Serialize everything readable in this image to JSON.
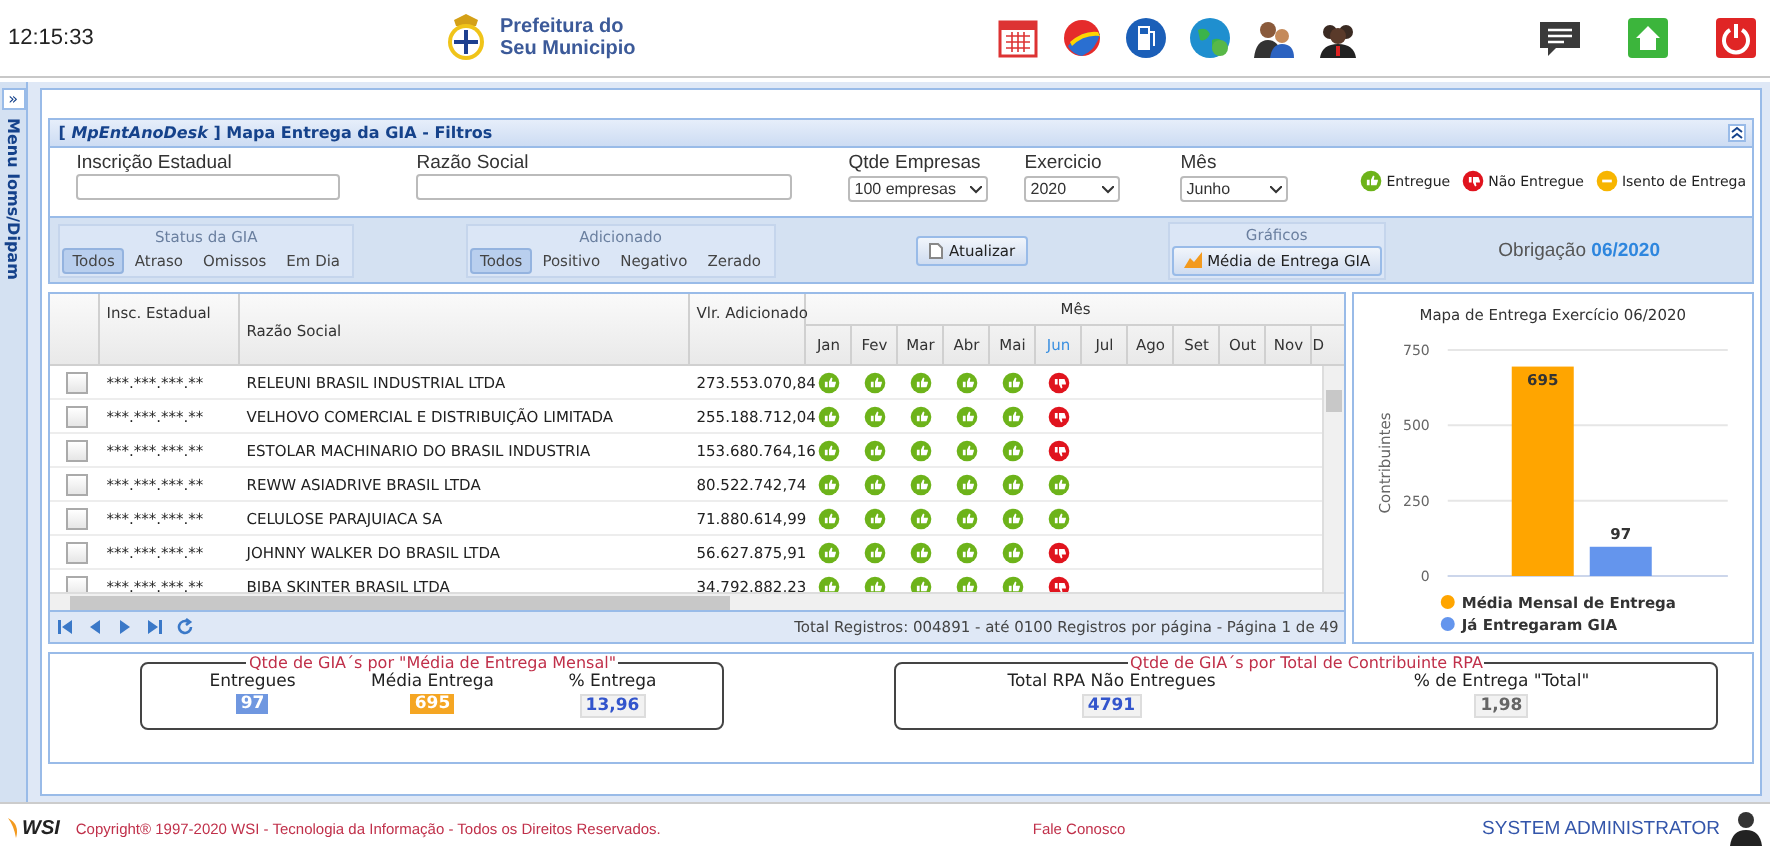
{
  "header": {
    "time": "12:15:33",
    "logo_lines": [
      "Prefeitura do",
      "Seu Municipio"
    ]
  },
  "sidebar": {
    "expand": "»",
    "label": "Menu Ioms/Dipam"
  },
  "panel": {
    "title": "[ *MpEntAnoDesk* ] Mapa Entrega da GIA - Filtros"
  },
  "filters": [
    {
      "kind": "input",
      "label": "Inscrição Estadual"
    },
    {
      "kind": "input",
      "label": "Razão Social"
    },
    {
      "kind": "select",
      "label": "Qtde Empresas",
      "value": "100 empresas"
    },
    {
      "kind": "select",
      "label": "Exercicio",
      "value": "2020"
    },
    {
      "kind": "select",
      "label": "Mês",
      "value": "Junho"
    }
  ],
  "legend": [
    {
      "kind": "entregue",
      "label": "Entregue"
    },
    {
      "kind": "nao_entregue",
      "label": "Não Entregue"
    },
    {
      "kind": "isento",
      "label": "Isento de Entrega"
    }
  ],
  "status_gia": {
    "title": "Status da GIA",
    "options": [
      {
        "label": "Todos",
        "selected": true
      },
      {
        "label": "Atraso",
        "selected": false
      },
      {
        "label": "Omissos",
        "selected": false
      },
      {
        "label": "Em Dia",
        "selected": false
      }
    ]
  },
  "adicionado": {
    "title": "Adicionado",
    "options": [
      {
        "label": "Todos",
        "selected": true
      },
      {
        "label": "Positivo",
        "selected": false
      },
      {
        "label": "Negativo",
        "selected": false
      },
      {
        "label": "Zerado",
        "selected": false
      }
    ]
  },
  "refresh_button": "Atualizar",
  "graficos": {
    "title": "Gráficos",
    "button": "Média de Entrega GIA"
  },
  "obrigacao": {
    "label": "Obrigação",
    "value": "06/2020"
  },
  "grid": {
    "columns": [
      "Insc. Estadual",
      "Razão Social",
      "Vlr. Adicionado"
    ],
    "month_group": "Mês",
    "months": [
      {
        "label": "Jan",
        "selected": false
      },
      {
        "label": "Fev",
        "selected": false
      },
      {
        "label": "Mar",
        "selected": false
      },
      {
        "label": "Abr",
        "selected": false
      },
      {
        "label": "Mai",
        "selected": false
      },
      {
        "label": "Jun",
        "selected": true
      },
      {
        "label": "Jul",
        "selected": false
      },
      {
        "label": "Ago",
        "selected": false
      },
      {
        "label": "Set",
        "selected": false
      },
      {
        "label": "Out",
        "selected": false
      },
      {
        "label": "Nov",
        "selected": false
      },
      {
        "label": "D",
        "selected": false
      }
    ],
    "rows": [
      {
        "checked": false,
        "insc": "***.***.***.**",
        "name": "RELEUNI BRASIL INDUSTRIAL LTDA",
        "value": "273.553.070,84",
        "months": [
          {
            "kind": "entregue"
          },
          {
            "kind": "entregue"
          },
          {
            "kind": "entregue"
          },
          {
            "kind": "entregue"
          },
          {
            "kind": "entregue"
          },
          {
            "kind": "nao_entregue"
          }
        ]
      },
      {
        "checked": false,
        "insc": "***.***.***.**",
        "name": "VELHOVO COMERCIAL E DISTRIBUIÇÃO LIMITADA",
        "value": "255.188.712,04",
        "months": [
          {
            "kind": "entregue"
          },
          {
            "kind": "entregue"
          },
          {
            "kind": "entregue"
          },
          {
            "kind": "entregue"
          },
          {
            "kind": "entregue"
          },
          {
            "kind": "nao_entregue"
          }
        ]
      },
      {
        "checked": false,
        "insc": "***.***.***.**",
        "name": "ESTOLAR MACHINARIO DO BRASIL INDUSTRIA",
        "value": "153.680.764,16",
        "months": [
          {
            "kind": "entregue"
          },
          {
            "kind": "entregue"
          },
          {
            "kind": "entregue"
          },
          {
            "kind": "entregue"
          },
          {
            "kind": "entregue"
          },
          {
            "kind": "nao_entregue"
          }
        ]
      },
      {
        "checked": false,
        "insc": "***.***.***.**",
        "name": "REWW ASIADRIVE BRASIL LTDA",
        "value": "80.522.742,74",
        "months": [
          {
            "kind": "entregue"
          },
          {
            "kind": "entregue"
          },
          {
            "kind": "entregue"
          },
          {
            "kind": "entregue"
          },
          {
            "kind": "entregue"
          },
          {
            "kind": "entregue"
          }
        ]
      },
      {
        "checked": false,
        "insc": "***.***.***.**",
        "name": "CELULOSE PARAJUIACA SA",
        "value": "71.880.614,99",
        "months": [
          {
            "kind": "entregue"
          },
          {
            "kind": "entregue"
          },
          {
            "kind": "entregue"
          },
          {
            "kind": "entregue"
          },
          {
            "kind": "entregue"
          },
          {
            "kind": "entregue"
          }
        ]
      },
      {
        "checked": false,
        "insc": "***.***.***.**",
        "name": "JOHNNY WALKER DO BRASIL LTDA",
        "value": "56.627.875,91",
        "months": [
          {
            "kind": "entregue"
          },
          {
            "kind": "entregue"
          },
          {
            "kind": "entregue"
          },
          {
            "kind": "entregue"
          },
          {
            "kind": "entregue"
          },
          {
            "kind": "nao_entregue"
          }
        ]
      },
      {
        "checked": false,
        "insc": "***.***.***.**",
        "name": "BIBA SKINTER BRASIL LTDA",
        "value": "34.792.882,23",
        "months": [
          {
            "kind": "entregue"
          },
          {
            "kind": "entregue"
          },
          {
            "kind": "entregue"
          },
          {
            "kind": "entregue"
          },
          {
            "kind": "entregue"
          },
          {
            "kind": "nao_entregue"
          }
        ]
      }
    ],
    "footer": "Total Registros: 004891 - até 0100 Registros por página - Página 1 de 49"
  },
  "chart": {
    "chart_data": {
      "type": "bar",
      "title": "Mapa de Entrega Exercício 06/2020",
      "ylabel": "Contribuintes",
      "ylim": [
        0,
        750
      ],
      "yticks": [
        0,
        250,
        500,
        750
      ],
      "data_labels": true,
      "legend": "bottom",
      "series": [
        {
          "name": "Média Mensal de Entrega",
          "color": "#ffa500",
          "values": [
            695
          ]
        },
        {
          "name": "Já Entregaram GIA",
          "color": "#6495ed",
          "values": [
            97
          ]
        }
      ]
    }
  },
  "summary": [
    {
      "title": "Qtde de GIA´s por \"Média de Entrega Mensal\"",
      "items": [
        {
          "label": "Entregues",
          "value": "97",
          "kind": "filled",
          "color": "#6f97e0"
        },
        {
          "label": "Média Entrega",
          "value": "695",
          "kind": "filled",
          "color": "#f5a623"
        },
        {
          "label": "% Entrega",
          "value": "13,96",
          "kind": "plain",
          "color": "#3355cc"
        }
      ]
    },
    {
      "title": "Qtde de GIA´s por Total de Contribuinte RPA",
      "items": [
        {
          "label": "Total RPA Não Entregues",
          "value": "4791",
          "kind": "plain",
          "color": "#3355cc"
        },
        {
          "label": "% de Entrega \"Total\"",
          "value": "1,98",
          "kind": "plain",
          "color": "#666666"
        }
      ]
    }
  ],
  "footer": {
    "logo": "WSI",
    "copyright": "Copyright® 1997-2020 WSI - Tecnologia da Informação - Todos os Direitos Reservados.",
    "contact": "Fale Conosco",
    "user": "SYSTEM ADMINISTRATOR"
  }
}
